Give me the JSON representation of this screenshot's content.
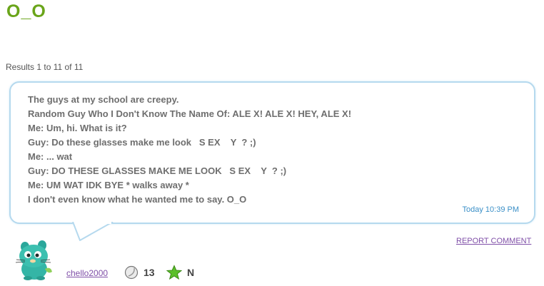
{
  "page": {
    "title": "O_O"
  },
  "results": {
    "text": "Results 1 to 11 of 11"
  },
  "comment": {
    "lines": [
      "The guys at my school are creepy.",
      "Random Guy Who I Don't Know The Name Of: ALE X! ALE X! HEY, ALE X!",
      "Me: Um, hi. What is it?",
      "Guy: Do these glasses make me look   S EX    Y  ? ;)",
      "Me: ... wat",
      "Guy: DO THESE GLASSES MAKE ME LOOK   S EX    Y  ? ;)",
      "Me: UM WAT IDK BYE * walks away *",
      "I don't even know what he wanted me to say. O_O"
    ],
    "timestamp": "Today 10:39 PM",
    "report_label": "REPORT COMMENT"
  },
  "author": {
    "username": "chello2000",
    "avatar_icon": "green-creature-avatar-icon",
    "level_icon": "moon-badge-icon",
    "level": "13",
    "rank_icon": "green-star-icon",
    "rank": "N"
  },
  "colors": {
    "title": "#6aa51a",
    "bubble_border": "#b5d9ee",
    "link": "#8050a8",
    "timestamp": "#3a8fc7",
    "text": "#6e6e6e"
  }
}
